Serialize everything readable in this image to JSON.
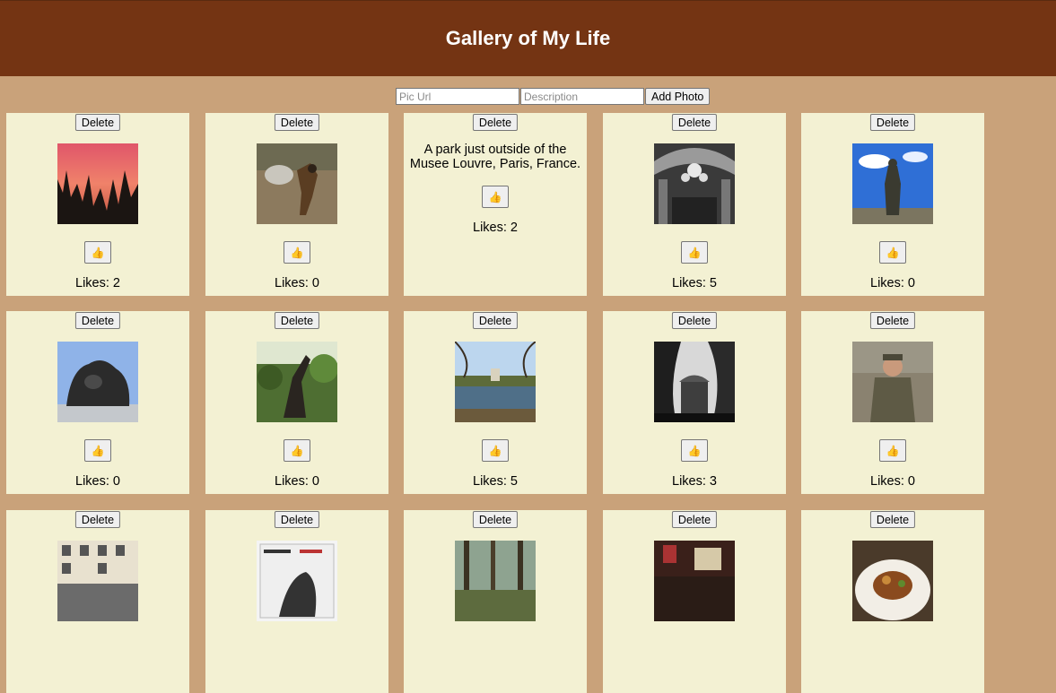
{
  "header": {
    "title": "Gallery of My Life"
  },
  "form": {
    "url_placeholder": "Pic Url",
    "description_placeholder": "Description",
    "add_label": "Add Photo"
  },
  "labels": {
    "delete": "Delete",
    "like_icon": "👍"
  },
  "photos": [
    {
      "likes": "Likes: 2",
      "icon": "sunset-forest-photo"
    },
    {
      "likes": "Likes: 0",
      "icon": "dog-rock-photo"
    },
    {
      "description": "A park just outside of the Musee Louvre, Paris, France.",
      "likes": "Likes: 2"
    },
    {
      "likes": "Likes: 5",
      "icon": "chandelier-hall-photo"
    },
    {
      "likes": "Likes: 0",
      "icon": "statue-blue-sky-photo"
    },
    {
      "likes": "Likes: 0",
      "icon": "bronze-sculpture-photo"
    },
    {
      "likes": "Likes: 0",
      "icon": "garden-sculpture-photo"
    },
    {
      "likes": "Likes: 5",
      "icon": "lake-park-photo"
    },
    {
      "likes": "Likes: 3",
      "icon": "bw-gazebo-photo"
    },
    {
      "likes": "Likes: 0",
      "icon": "soldier-photo"
    },
    {
      "icon": "street-building-photo"
    },
    {
      "icon": "meat-bucket-poster-photo"
    },
    {
      "icon": "pine-forest-photo"
    },
    {
      "icon": "restaurant-interior-photo"
    },
    {
      "icon": "food-plate-photo"
    }
  ]
}
